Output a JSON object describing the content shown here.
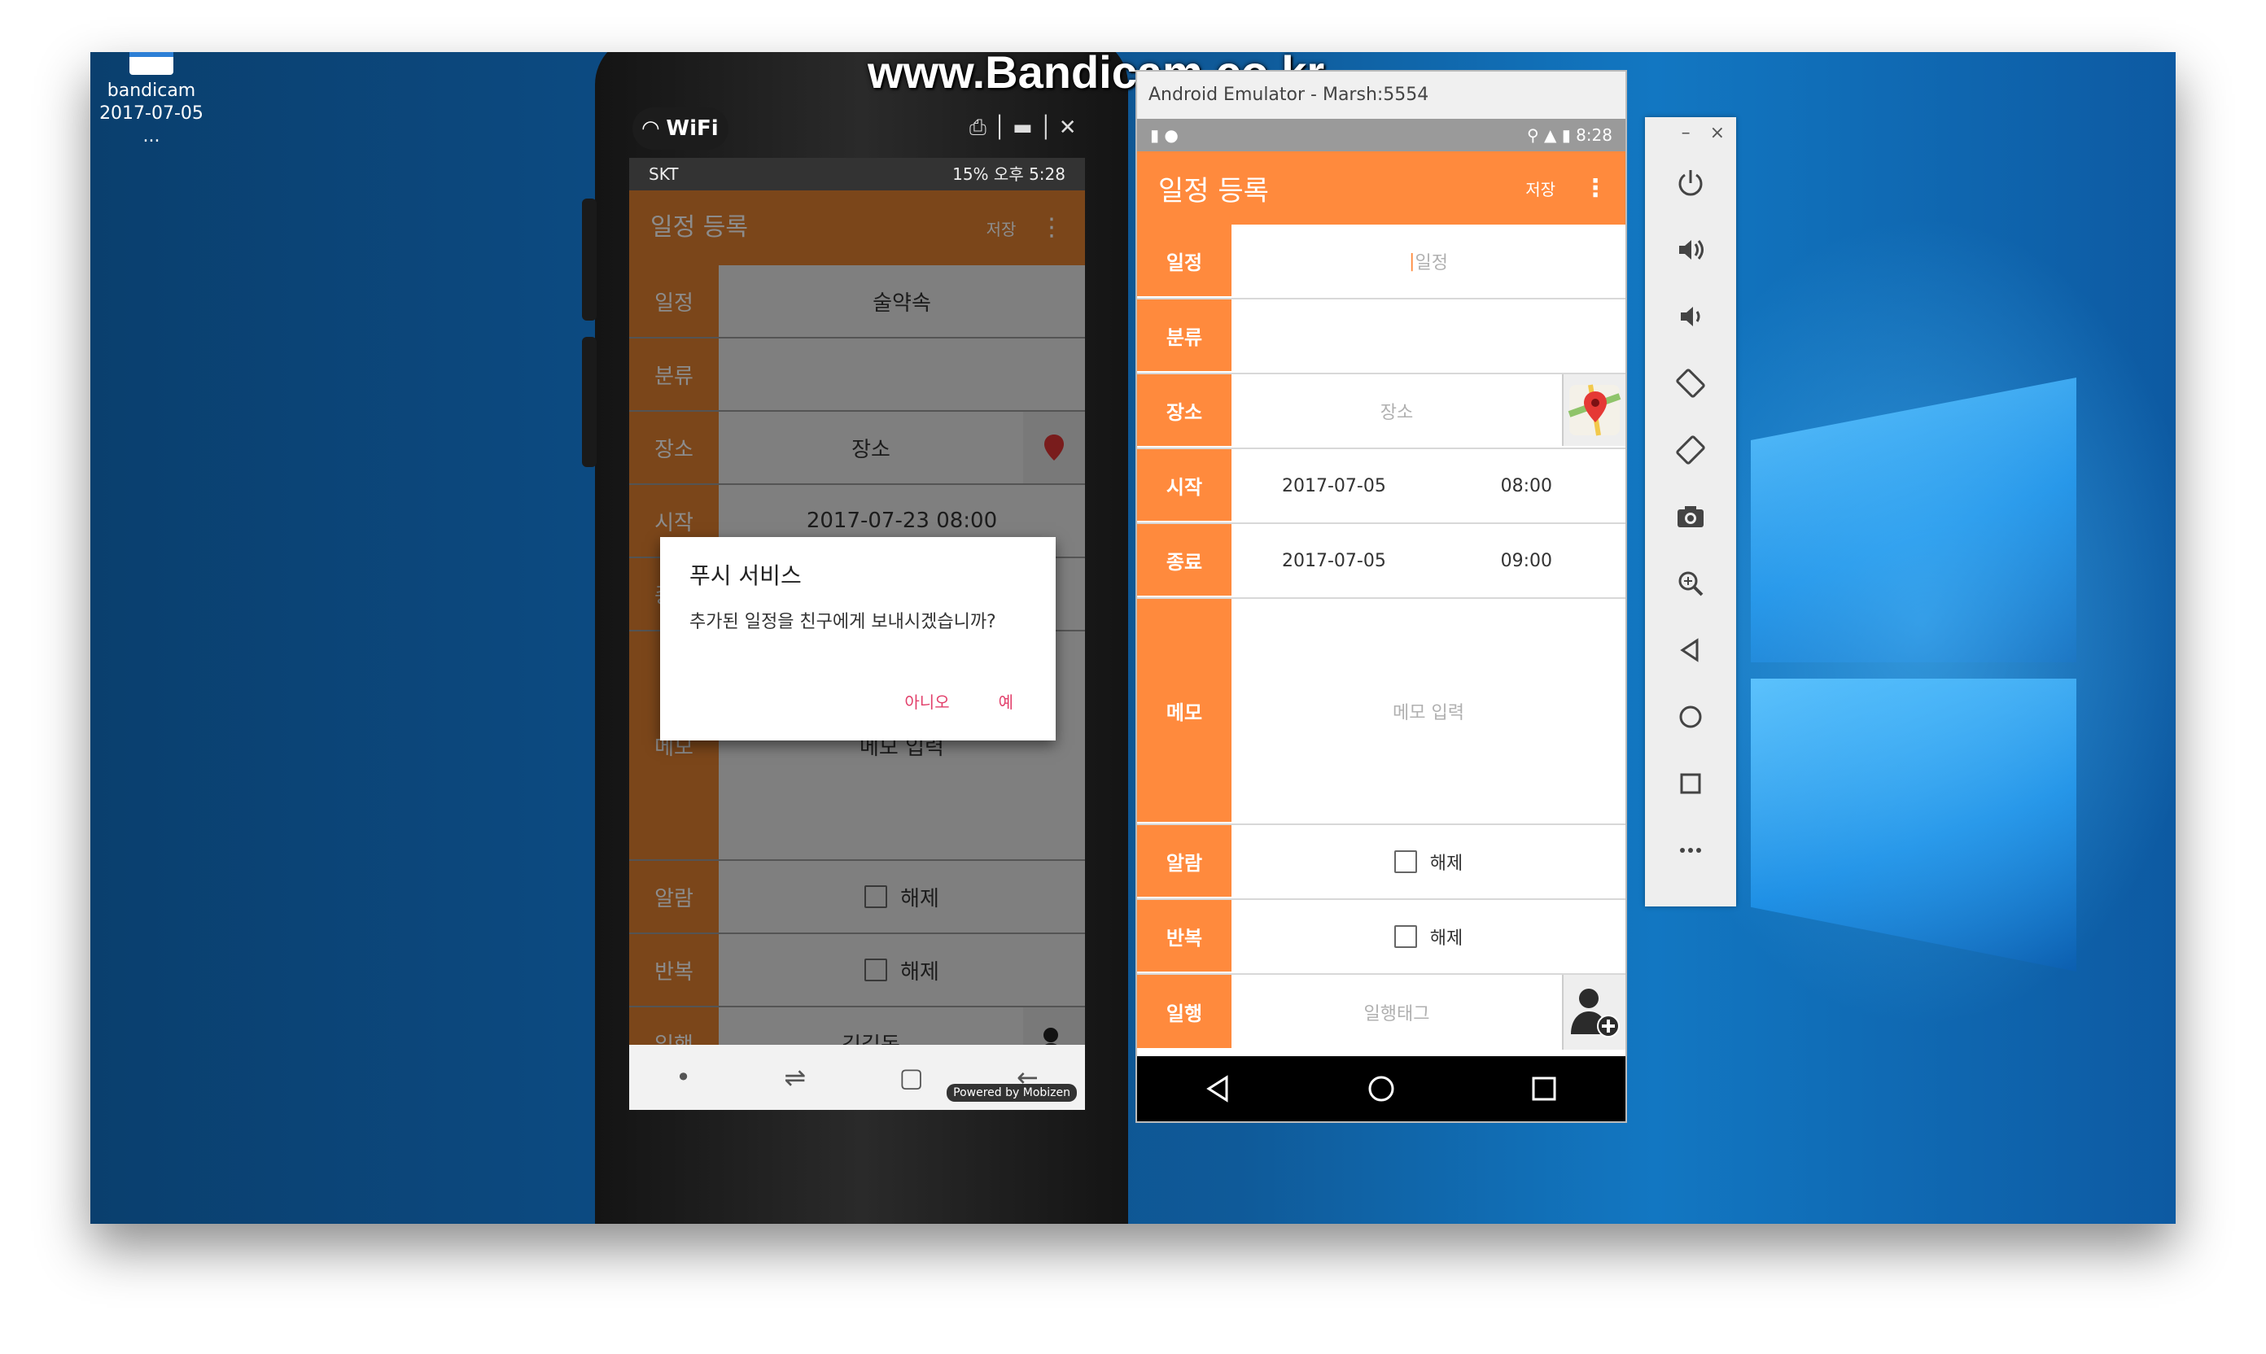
{
  "watermark": "www.Bandicam.co.kr",
  "desktop_icon": {
    "line1": "bandicam",
    "line2": "2017-07-05 ..."
  },
  "phone": {
    "wifi_label": "WiFi",
    "carrier": "SKT",
    "status_right": "15% 오후 5:28",
    "appbar_title": "일정 등록",
    "appbar_save": "저장",
    "rows": [
      {
        "label": "일정",
        "value": "술약속"
      },
      {
        "label": "분류",
        "value": ""
      },
      {
        "label": "장소",
        "value": "장소"
      },
      {
        "label": "시작",
        "value": "2017-07-23      08:00"
      },
      {
        "label": "종료",
        "value": ""
      },
      {
        "label": "메모",
        "value": "메모 입력"
      },
      {
        "label": "알람",
        "value": "해제"
      },
      {
        "label": "반복",
        "value": "해제"
      },
      {
        "label": "일행",
        "value": "김길동"
      }
    ],
    "dialog": {
      "title": "푸시 서비스",
      "body": "추가된 일정을 친구에게 보내시겠습니까?",
      "no": "아니오",
      "yes": "예"
    },
    "powered_by": "Powered by Mobizen"
  },
  "emulator": {
    "window_title": "Android Emulator - Marsh:5554",
    "clock": "8:28",
    "appbar_title": "일정 등록",
    "save_label": "저장",
    "schedule": {
      "label": "일정",
      "placeholder": "일정"
    },
    "category": {
      "label": "분류",
      "value": ""
    },
    "place": {
      "label": "장소",
      "placeholder": "장소"
    },
    "start": {
      "label": "시작",
      "date": "2017-07-05",
      "time": "08:00"
    },
    "end": {
      "label": "종료",
      "date": "2017-07-05",
      "time": "09:00"
    },
    "memo": {
      "label": "메모",
      "placeholder": "메모 입력"
    },
    "alarm": {
      "label": "알람",
      "text": "해제",
      "checked": false
    },
    "repeat": {
      "label": "반복",
      "text": "해제",
      "checked": false
    },
    "companion": {
      "label": "일행",
      "placeholder": "일행태그"
    },
    "accent": "#ff8a3d"
  },
  "toolbar": {
    "minimize": "–",
    "close": "×",
    "tools": [
      "power-icon",
      "volume-up-icon",
      "volume-down-icon",
      "rotate-left-icon",
      "rotate-right-icon",
      "camera-icon",
      "zoom-icon",
      "back-icon",
      "home-icon",
      "overview-icon",
      "more-icon"
    ]
  }
}
